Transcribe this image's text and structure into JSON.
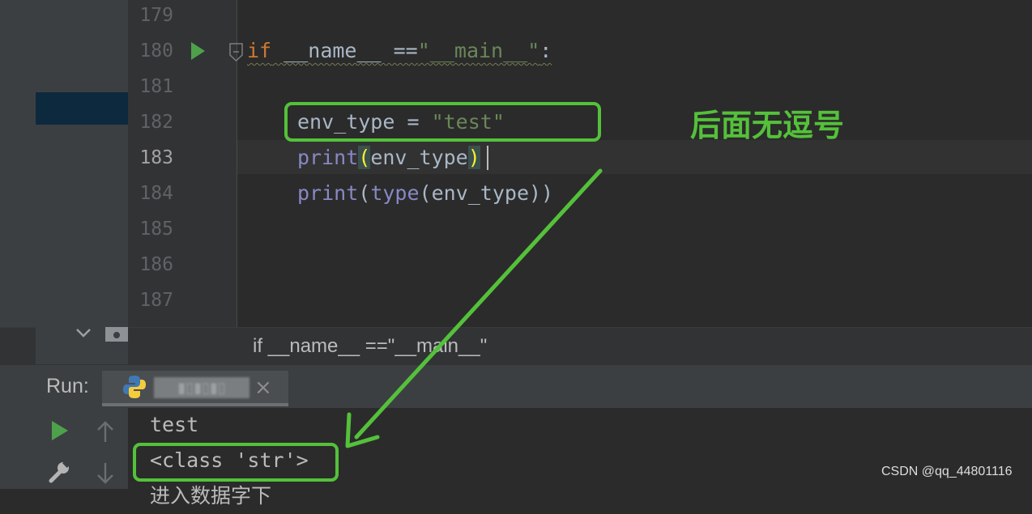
{
  "editor": {
    "line_numbers": [
      "179",
      "180",
      "181",
      "182",
      "183",
      "184",
      "185",
      "186",
      "187"
    ],
    "current_line": "183",
    "code": {
      "l180_keyword": "if",
      "l180_rest": " __name__ ==",
      "l180_string": "\"__main__\"",
      "l180_colon": ":",
      "l182_var": "env_type = ",
      "l182_string": "\"test\"",
      "l183_func": "print",
      "l183_open": "(",
      "l183_arg": "env_type",
      "l183_close": ")",
      "l184_func": "print",
      "l184_open": "(",
      "l184_inner": "type",
      "l184_rest": "(env_type))"
    }
  },
  "breadcrumb": {
    "text": "if __name__ ==\"__main__\""
  },
  "run_panel": {
    "label": "Run:",
    "tab_name": "▮▯▮▯▮▯",
    "close_glyph": "×",
    "output": [
      "test",
      "<class 'str'>",
      "进入数据字下"
    ]
  },
  "annotation": {
    "note": "后面无逗号",
    "color": "#54c13a"
  },
  "watermark": "CSDN @qq_44801116",
  "colors": {
    "editor_bg": "#2b2b2b",
    "gutter_bg": "#313335",
    "keyword": "#cc7832",
    "string": "#6a8759",
    "builtin": "#8888c6",
    "run_icon": "#4ea14b"
  }
}
